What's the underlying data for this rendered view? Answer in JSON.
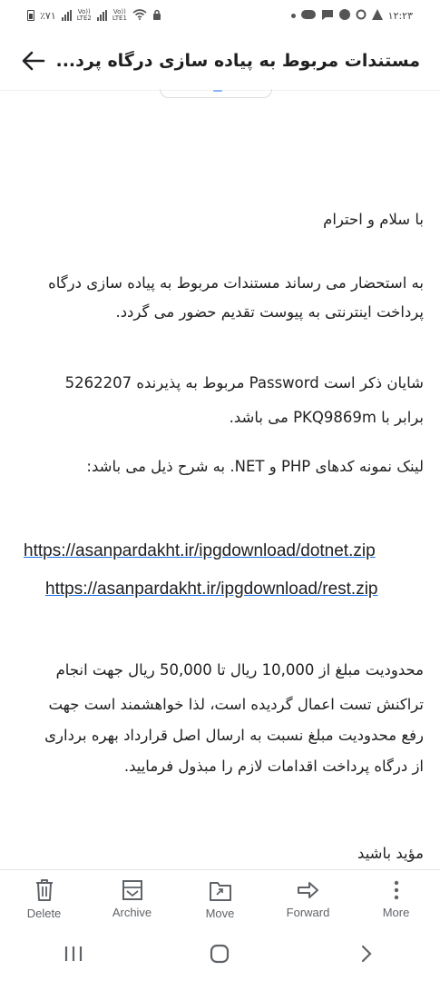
{
  "status_bar": {
    "time": "۱۲:۲۳",
    "battery": "٪۷۱",
    "sim1_label": "Vo))",
    "sim1_sub": "LTE2",
    "sim2_label": "Vo))",
    "sim2_sub": "LTE1"
  },
  "header": {
    "subject": "مستندات مربوط به پیاده سازی درگاه پرد..."
  },
  "message": {
    "greeting": "با سلام و احترام",
    "para1_line1": "به استحضار می رساند مستندات مربوط به پیاده سازی درگاه",
    "para1_line2": "پرداخت اینترنتی به پیوست تقدیم حضور می گردد.",
    "para2_line1": "شایان ذکر است Password مربوط به پذیرنده  5262207",
    "para2_line2": "برابر با PKQ9869m می باشد.",
    "para3": "لینک نمونه کدهای PHP و NET. به شرح ذیل می باشد:",
    "link1": "https://asanpardakht.ir/ipgdownload/dotnet.zip",
    "link2": "https://asanpardakht.ir/ipgdownload/rest.zip",
    "para4_line1": "محدودیت مبلغ از 10,000 ریال تا 50,000 ریال جهت انجام",
    "para4_line2": "تراکنش تست اعمال گردیده است، لذا خواهشمند است جهت",
    "para4_line3": "رفع محدودیت مبلغ نسبت به ارسال اصل قرارداد بهره برداری",
    "para4_line4": "از درگاه پرداخت اقدامات لازم را مبذول فرمایید.",
    "closing": "مؤید باشید"
  },
  "actions": [
    {
      "label": "Delete",
      "icon": "trash-icon"
    },
    {
      "label": "Archive",
      "icon": "archive-icon"
    },
    {
      "label": "Move",
      "icon": "move-icon"
    },
    {
      "label": "Forward",
      "icon": "forward-icon"
    },
    {
      "label": "More",
      "icon": "more-vertical-icon"
    }
  ],
  "colors": {
    "link_underline": "#1a73e8",
    "icon_gray": "#5f6368"
  }
}
